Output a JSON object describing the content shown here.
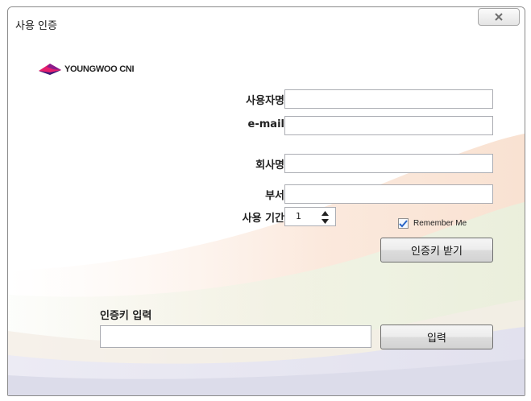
{
  "window": {
    "title": "사용 인증",
    "close_icon": "close-icon"
  },
  "logo": {
    "text": "YOUNGWOO CNI",
    "icon": "diamond-logo-icon",
    "colors": [
      "#e61e6e",
      "#8a1c8c",
      "#3a1d7a"
    ]
  },
  "form": {
    "username_label": "사용자명",
    "username_value": "",
    "email_label": "e-mail",
    "email_value": "",
    "company_label": "회사명",
    "company_value": "",
    "department_label": "부서",
    "department_value": "",
    "period_label": "사용 기간",
    "period_value": "1",
    "remember_label": "Remember Me",
    "remember_checked": true,
    "get_key_button": "인증키 받기"
  },
  "key_entry": {
    "label": "인증키 입력",
    "value": "",
    "submit_button": "입력"
  }
}
